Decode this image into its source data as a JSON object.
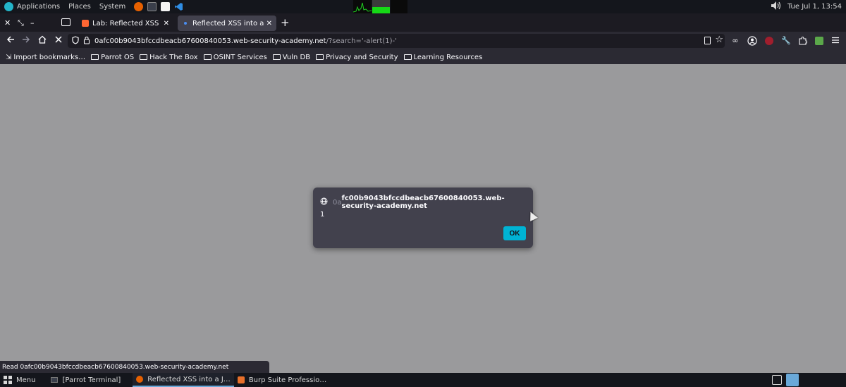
{
  "system_panel": {
    "menus": [
      "Applications",
      "Places",
      "System"
    ],
    "clock": "Tue Jul 1, 13:54"
  },
  "tabs": [
    {
      "title": "Lab: Reflected XSS into a JavaScript string",
      "active": false
    },
    {
      "title": "Reflected XSS into a JavaScript string",
      "active": true
    }
  ],
  "window_controls": {
    "close": "✕",
    "restore": "⤡",
    "minimize": "–"
  },
  "new_tab": "+",
  "url": {
    "host": "0afc00b9043bfccdbeacb67600840053.web-security-academy.net",
    "path": "/?search='-alert(1)-'"
  },
  "bookmarks": [
    "Import bookmarks…",
    "Parrot OS",
    "Hack The Box",
    "OSINT Services",
    "Vuln DB",
    "Privacy and Security",
    "Learning Resources"
  ],
  "dialog": {
    "origin_dim": "0a",
    "origin_rest": "fc00b9043bfccdbeacb67600840053.web-security-academy.net",
    "message": "1",
    "ok_label": "OK"
  },
  "status_text": "Read 0afc00b9043bfccdbeacb67600840053.web-security-academy.net",
  "taskbar": {
    "menu_label": "Menu",
    "tasks": [
      {
        "label": "[Parrot Terminal]",
        "active": false
      },
      {
        "label": "Reflected XSS into a J…",
        "active": true
      },
      {
        "label": "Burp Suite Professio…",
        "active": false
      }
    ]
  },
  "colors": {
    "accent": "#00b3d4",
    "page_background": "#9a9a9c",
    "dialog_background": "#42414d"
  }
}
